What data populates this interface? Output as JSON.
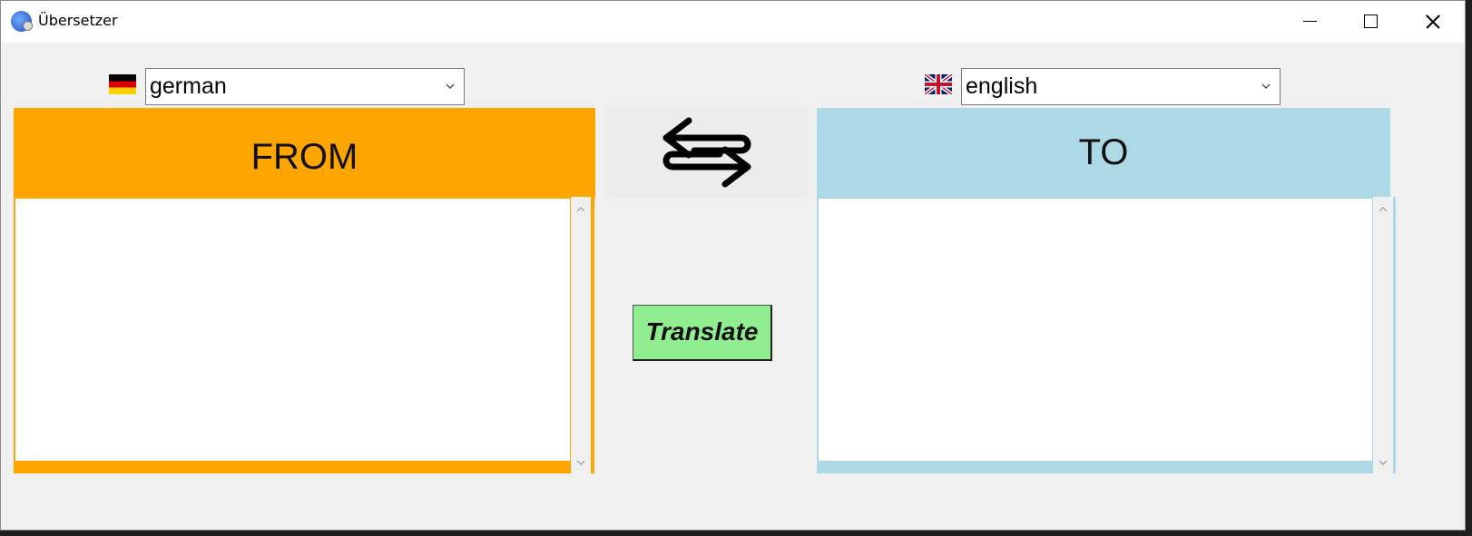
{
  "window": {
    "title": "Übersetzer"
  },
  "source": {
    "language": "german",
    "flag": "german-flag",
    "header": "FROM",
    "text": "",
    "accent": "#ffa500"
  },
  "target": {
    "language": "english",
    "flag": "uk-flag",
    "header": "TO",
    "text": "",
    "accent": "#add8e6"
  },
  "actions": {
    "swap_icon": "swap-arrows-icon",
    "translate_label": "Translate",
    "translate_color": "#90ee90"
  }
}
